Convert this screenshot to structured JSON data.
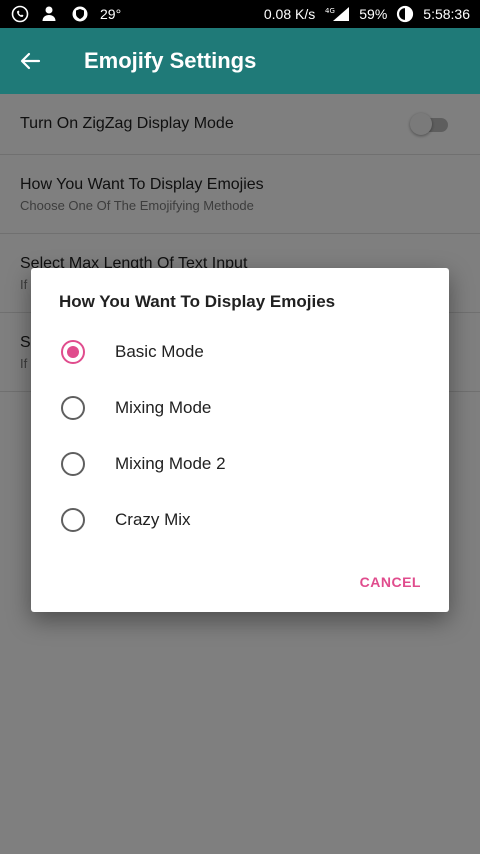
{
  "status_bar": {
    "temperature": "29°",
    "network_speed": "0.08 K/s",
    "network_type": "4G",
    "battery": "59%",
    "time": "5:58:36",
    "icons": [
      "whatsapp-icon",
      "person-icon",
      "shield-icon",
      "signal-icon",
      "battery-ring-icon"
    ]
  },
  "app_bar": {
    "title": "Emojify Settings",
    "back_icon": "arrow-left-icon",
    "color": "#1f7a78"
  },
  "settings": [
    {
      "title": "Turn On ZigZag Display Mode",
      "toggle_on": false
    },
    {
      "title": "How You Want To Display Emojies",
      "subtitle": "Choose One Of The Emojifying Methode"
    },
    {
      "title": "Select Max Length Of Text Input",
      "subtitle": "If"
    },
    {
      "title": "Se",
      "subtitle": "If"
    }
  ],
  "dialog": {
    "title": "How You Want To Display Emojies",
    "options": [
      {
        "label": "Basic Mode",
        "selected": true
      },
      {
        "label": "Mixing Mode",
        "selected": false
      },
      {
        "label": "Mixing Mode 2",
        "selected": false
      },
      {
        "label": "Crazy Mix",
        "selected": false
      }
    ],
    "cancel_label": "CANCEL",
    "accent_color": "#e04c8d"
  }
}
